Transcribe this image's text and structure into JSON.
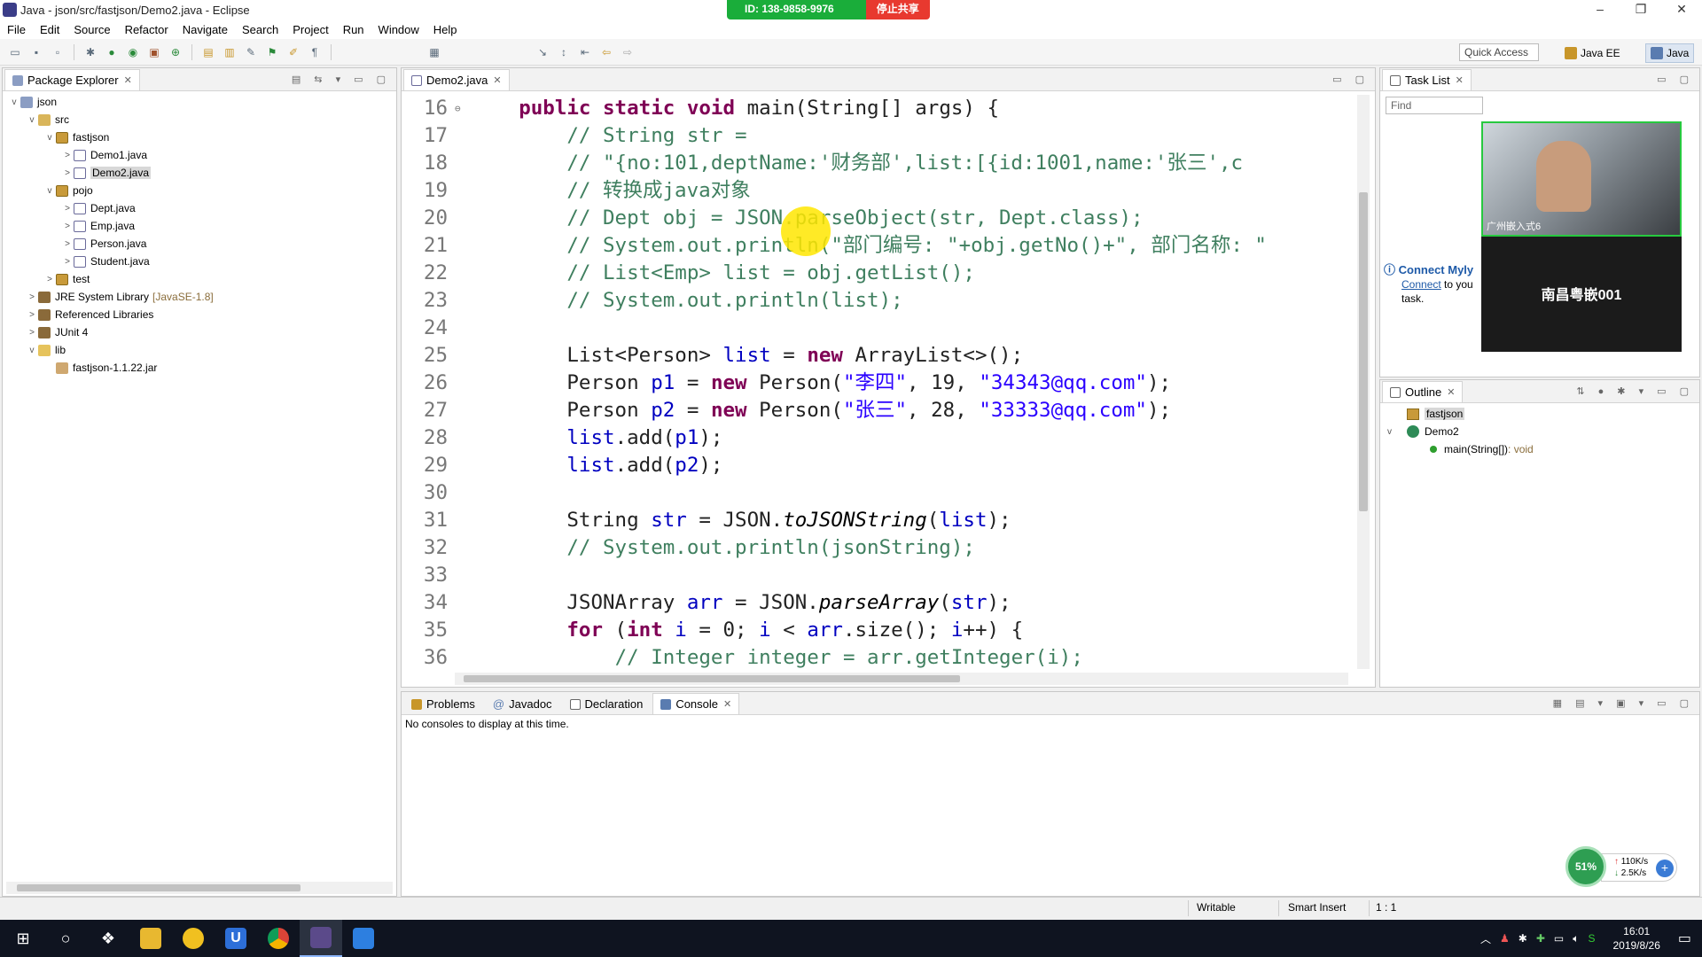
{
  "window": {
    "title": "Java - json/src/fastjson/Demo2.java - Eclipse",
    "minimize": "–",
    "restore": "❐",
    "close": "✕"
  },
  "share_bar": {
    "id_text": "ID: 138-9858-9976",
    "stop_text": "停止共享"
  },
  "menu": [
    "File",
    "Edit",
    "Source",
    "Refactor",
    "Navigate",
    "Search",
    "Project",
    "Run",
    "Window",
    "Help"
  ],
  "toolbar": {
    "quick_access": "Quick Access",
    "perspectives": [
      "Java EE",
      "Java"
    ]
  },
  "package_explorer": {
    "tab_label": "Package Explorer",
    "tree": [
      {
        "label": "json",
        "toggle": "v",
        "icon": "project"
      },
      {
        "label": "src",
        "toggle": "v",
        "icon": "source-folder"
      },
      {
        "label": "fastjson",
        "toggle": "v",
        "icon": "package"
      },
      {
        "label": "Demo1.java",
        "toggle": ">",
        "icon": "java-file"
      },
      {
        "label": "Demo2.java",
        "toggle": ">",
        "icon": "java-file"
      },
      {
        "label": "pojo",
        "toggle": "v",
        "icon": "package"
      },
      {
        "label": "Dept.java",
        "toggle": ">",
        "icon": "java-file"
      },
      {
        "label": "Emp.java",
        "toggle": ">",
        "icon": "java-file"
      },
      {
        "label": "Person.java",
        "toggle": ">",
        "icon": "java-file"
      },
      {
        "label": "Student.java",
        "toggle": ">",
        "icon": "java-file"
      },
      {
        "label": "test",
        "toggle": ">",
        "icon": "package"
      },
      {
        "label": "JRE System Library",
        "suffix": "[JavaSE-1.8]",
        "toggle": ">",
        "icon": "library"
      },
      {
        "label": "Referenced Libraries",
        "toggle": ">",
        "icon": "library"
      },
      {
        "label": "JUnit 4",
        "toggle": ">",
        "icon": "library"
      },
      {
        "label": "lib",
        "toggle": "v",
        "icon": "folder"
      },
      {
        "label": "fastjson-1.1.22.jar",
        "toggle": "",
        "icon": "jar"
      }
    ]
  },
  "editor": {
    "tab_label": "Demo2.java",
    "lines": [
      {
        "n": "16",
        "fold": "⊖",
        "tokens": [
          [
            "ct",
            "    "
          ],
          [
            "kw",
            "public"
          ],
          [
            "ct",
            " "
          ],
          [
            "kw",
            "static"
          ],
          [
            "ct",
            " "
          ],
          [
            "kw",
            "void"
          ],
          [
            "ct",
            " main(String[] args) {"
          ]
        ]
      },
      {
        "n": "17",
        "tokens": [
          [
            "ct",
            "        "
          ],
          [
            "cm",
            "// String str ="
          ]
        ]
      },
      {
        "n": "18",
        "tokens": [
          [
            "ct",
            "        "
          ],
          [
            "cm",
            "// \"{no:101,deptName:'财务部',list:[{id:1001,name:'张三',c"
          ]
        ]
      },
      {
        "n": "19",
        "tokens": [
          [
            "ct",
            "        "
          ],
          [
            "cm",
            "// 转换成java对象"
          ]
        ]
      },
      {
        "n": "20",
        "tokens": [
          [
            "ct",
            "        "
          ],
          [
            "cm",
            "// Dept obj = JSON.parseObject(str, Dept.class);"
          ]
        ]
      },
      {
        "n": "21",
        "tokens": [
          [
            "ct",
            "        "
          ],
          [
            "cm",
            "// System.out.println(\"部门编号: \"+obj.getNo()+\", 部门名称: \""
          ]
        ]
      },
      {
        "n": "22",
        "tokens": [
          [
            "ct",
            "        "
          ],
          [
            "cm",
            "// List<Emp> list = obj.getList();"
          ]
        ]
      },
      {
        "n": "23",
        "tokens": [
          [
            "ct",
            "        "
          ],
          [
            "cm",
            "// System.out.println(list);"
          ]
        ]
      },
      {
        "n": "24",
        "tokens": [
          [
            "ct",
            ""
          ]
        ]
      },
      {
        "n": "25",
        "tokens": [
          [
            "ct",
            "        List<Person> "
          ],
          [
            "var",
            "list"
          ],
          [
            "ct",
            " = "
          ],
          [
            "kw",
            "new"
          ],
          [
            "ct",
            " ArrayList<>();"
          ]
        ]
      },
      {
        "n": "26",
        "tokens": [
          [
            "ct",
            "        Person "
          ],
          [
            "var",
            "p1"
          ],
          [
            "ct",
            " = "
          ],
          [
            "kw",
            "new"
          ],
          [
            "ct",
            " Person("
          ],
          [
            "st",
            "\"李四\""
          ],
          [
            "ct",
            ", 19, "
          ],
          [
            "st",
            "\"34343@qq.com\""
          ],
          [
            "ct",
            ");"
          ]
        ]
      },
      {
        "n": "27",
        "tokens": [
          [
            "ct",
            "        Person "
          ],
          [
            "var",
            "p2"
          ],
          [
            "ct",
            " = "
          ],
          [
            "kw",
            "new"
          ],
          [
            "ct",
            " Person("
          ],
          [
            "st",
            "\"张三\""
          ],
          [
            "ct",
            ", 28, "
          ],
          [
            "st",
            "\"33333@qq.com\""
          ],
          [
            "ct",
            ");"
          ]
        ]
      },
      {
        "n": "28",
        "tokens": [
          [
            "ct",
            "        "
          ],
          [
            "var",
            "list"
          ],
          [
            "ct",
            ".add("
          ],
          [
            "var",
            "p1"
          ],
          [
            "ct",
            ");"
          ]
        ]
      },
      {
        "n": "29",
        "tokens": [
          [
            "ct",
            "        "
          ],
          [
            "var",
            "list"
          ],
          [
            "ct",
            ".add("
          ],
          [
            "var",
            "p2"
          ],
          [
            "ct",
            ");"
          ]
        ]
      },
      {
        "n": "30",
        "tokens": [
          [
            "ct",
            ""
          ]
        ]
      },
      {
        "n": "31",
        "tokens": [
          [
            "ct",
            "        String "
          ],
          [
            "var",
            "str"
          ],
          [
            "ct",
            " = JSON."
          ],
          [
            "it",
            "toJSONString"
          ],
          [
            "ct",
            "("
          ],
          [
            "var",
            "list"
          ],
          [
            "ct",
            ");"
          ]
        ]
      },
      {
        "n": "32",
        "tokens": [
          [
            "ct",
            "        "
          ],
          [
            "cm",
            "// System.out.println(jsonString);"
          ]
        ]
      },
      {
        "n": "33",
        "tokens": [
          [
            "ct",
            ""
          ]
        ]
      },
      {
        "n": "34",
        "tokens": [
          [
            "ct",
            "        JSONArray "
          ],
          [
            "var",
            "arr"
          ],
          [
            "ct",
            " = JSON."
          ],
          [
            "it",
            "parseArray"
          ],
          [
            "ct",
            "("
          ],
          [
            "var",
            "str"
          ],
          [
            "ct",
            ");"
          ]
        ]
      },
      {
        "n": "35",
        "tokens": [
          [
            "ct",
            "        "
          ],
          [
            "kw",
            "for"
          ],
          [
            "ct",
            " ("
          ],
          [
            "kw",
            "int"
          ],
          [
            "ct",
            " "
          ],
          [
            "var",
            "i"
          ],
          [
            "ct",
            " = 0; "
          ],
          [
            "var",
            "i"
          ],
          [
            "ct",
            " < "
          ],
          [
            "var",
            "arr"
          ],
          [
            "ct",
            ".size(); "
          ],
          [
            "var",
            "i"
          ],
          [
            "ct",
            "++) {"
          ]
        ]
      },
      {
        "n": "36",
        "tokens": [
          [
            "ct",
            "            "
          ],
          [
            "cm",
            "// Integer integer = arr.getInteger(i);"
          ]
        ]
      }
    ]
  },
  "task_list": {
    "tab_label": "Task List",
    "find_placeholder": "Find",
    "connect_title": "Connect Myly",
    "connect_link": "Connect",
    "connect_rest": " to you",
    "connect_line2": "task."
  },
  "video": {
    "caption": "广州嵌入式6",
    "name": "南昌粤嵌001"
  },
  "outline": {
    "tab_label": "Outline",
    "items": [
      {
        "label": "fastjson",
        "indent": 0
      },
      {
        "label": "Demo2",
        "indent": 1
      },
      {
        "label": "main(String[])",
        "suffix": " : void",
        "indent": 2
      }
    ]
  },
  "bottom_panel": {
    "tabs": [
      "Problems",
      "Javadoc",
      "Declaration",
      "Console"
    ],
    "console_message": "No consoles to display at this time."
  },
  "status_bar": {
    "writable": "Writable",
    "insert_mode": "Smart Insert",
    "position": "1 : 1"
  },
  "network_widget": {
    "percent": "51%",
    "upload": "110K/s",
    "download": "2.5K/s"
  },
  "taskbar": {
    "time": "16:01",
    "date": "2019/8/26"
  }
}
